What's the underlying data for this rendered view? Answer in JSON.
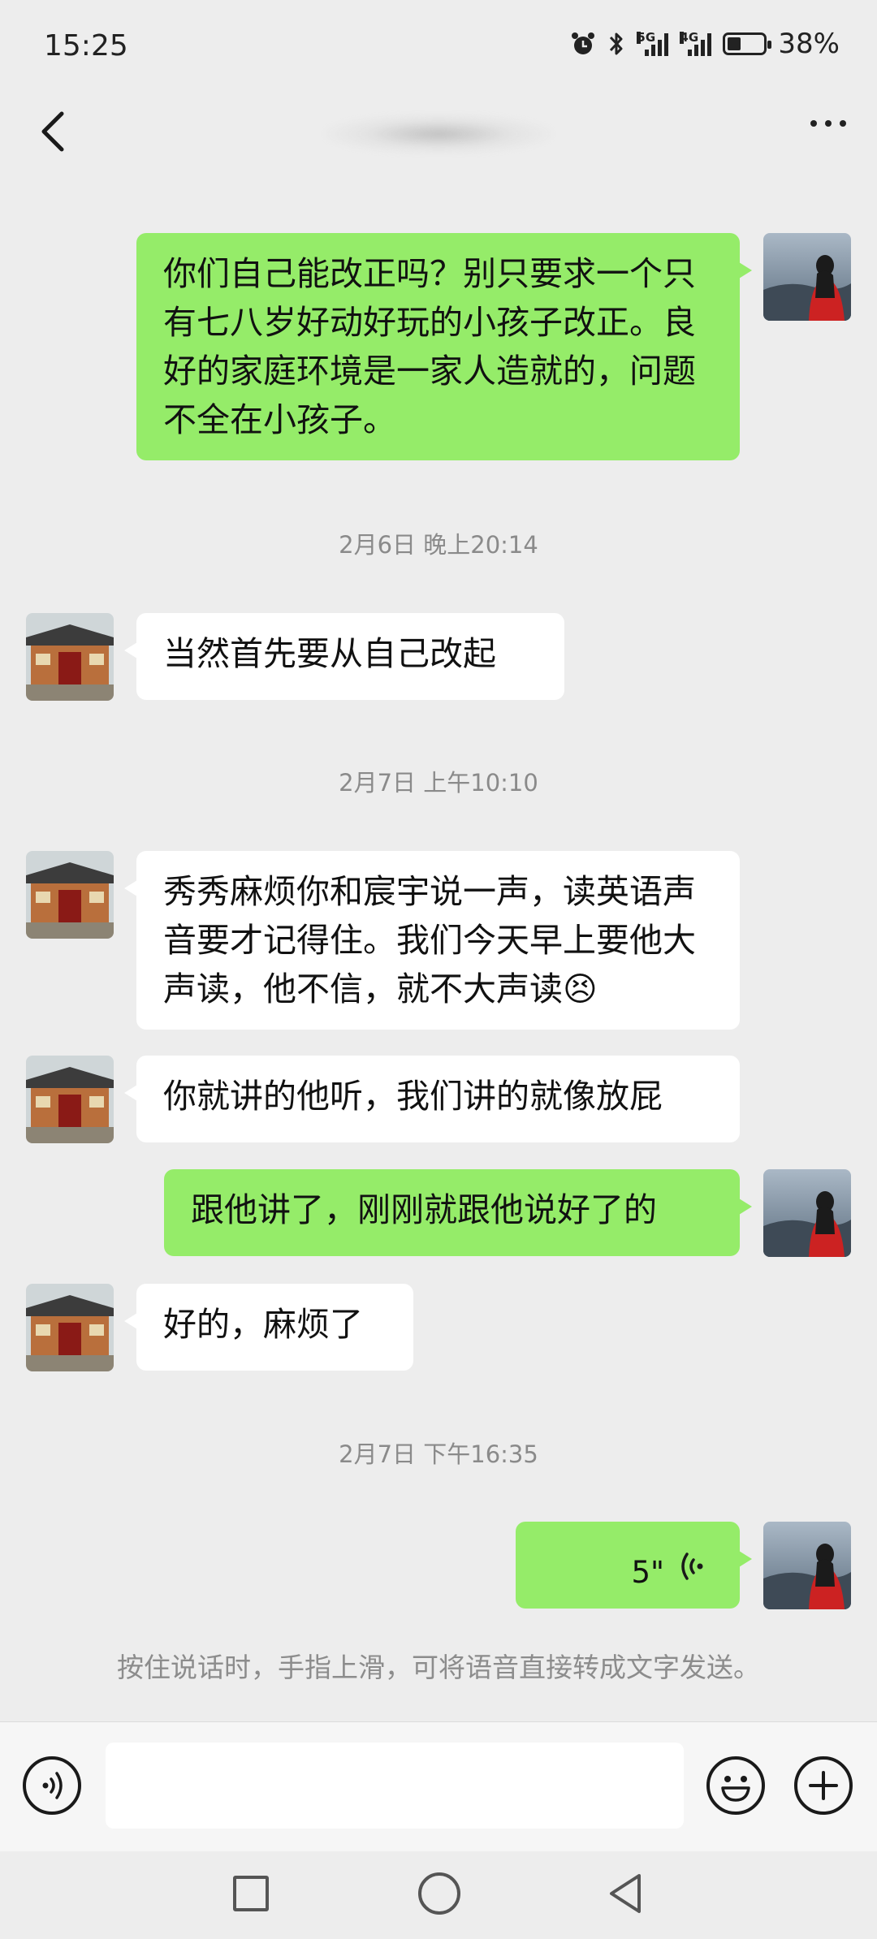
{
  "status_bar": {
    "time": "15:25",
    "signal1_label": "5G",
    "signal2_label": "4G",
    "battery_percent": "38%",
    "battery_level": 0.38,
    "icons": [
      "alarm-icon",
      "bluetooth-icon",
      "signal-icon",
      "battery-icon"
    ]
  },
  "header": {
    "contact_name": "",
    "back_icon": "chevron-left-icon",
    "more_icon": "more-dots-icon"
  },
  "messages": [
    {
      "type": "text",
      "sender": "me",
      "text": "你们自己能改正吗？别只要求一个只有七八岁好动好玩的小孩子改正。良好的家庭环境是一家人造就的，问题不全在小孩子。"
    },
    {
      "type": "time",
      "text": "2月6日 晚上20:14"
    },
    {
      "type": "text",
      "sender": "other",
      "text": "当然首先要从自己改起"
    },
    {
      "type": "time",
      "text": "2月7日 上午10:10"
    },
    {
      "type": "text",
      "sender": "other",
      "text": "秀秀麻烦你和宸宇说一声，读英语声音要才记得住。我们今天早上要他大声读，他不信，就不大声读😣"
    },
    {
      "type": "text",
      "sender": "other",
      "text": "你就讲的他听，我们讲的就像放屁"
    },
    {
      "type": "text",
      "sender": "me",
      "text": "跟他讲了，刚刚就跟他说好了的"
    },
    {
      "type": "text",
      "sender": "other",
      "text": "好的，麻烦了"
    },
    {
      "type": "time",
      "text": "2月7日 下午16:35"
    },
    {
      "type": "voice",
      "sender": "me",
      "duration": "5\""
    }
  ],
  "hint": "按住说话时，手指上滑，可将语音直接转成文字发送。",
  "input_bar": {
    "voice_icon": "voice-mode-icon",
    "emoji_icon": "emoji-icon",
    "plus_icon": "plus-icon",
    "text_value": ""
  },
  "colors": {
    "background": "#ededed",
    "my_bubble": "#95ec69",
    "other_bubble": "#ffffff",
    "timestamp": "#8a8a8a"
  }
}
